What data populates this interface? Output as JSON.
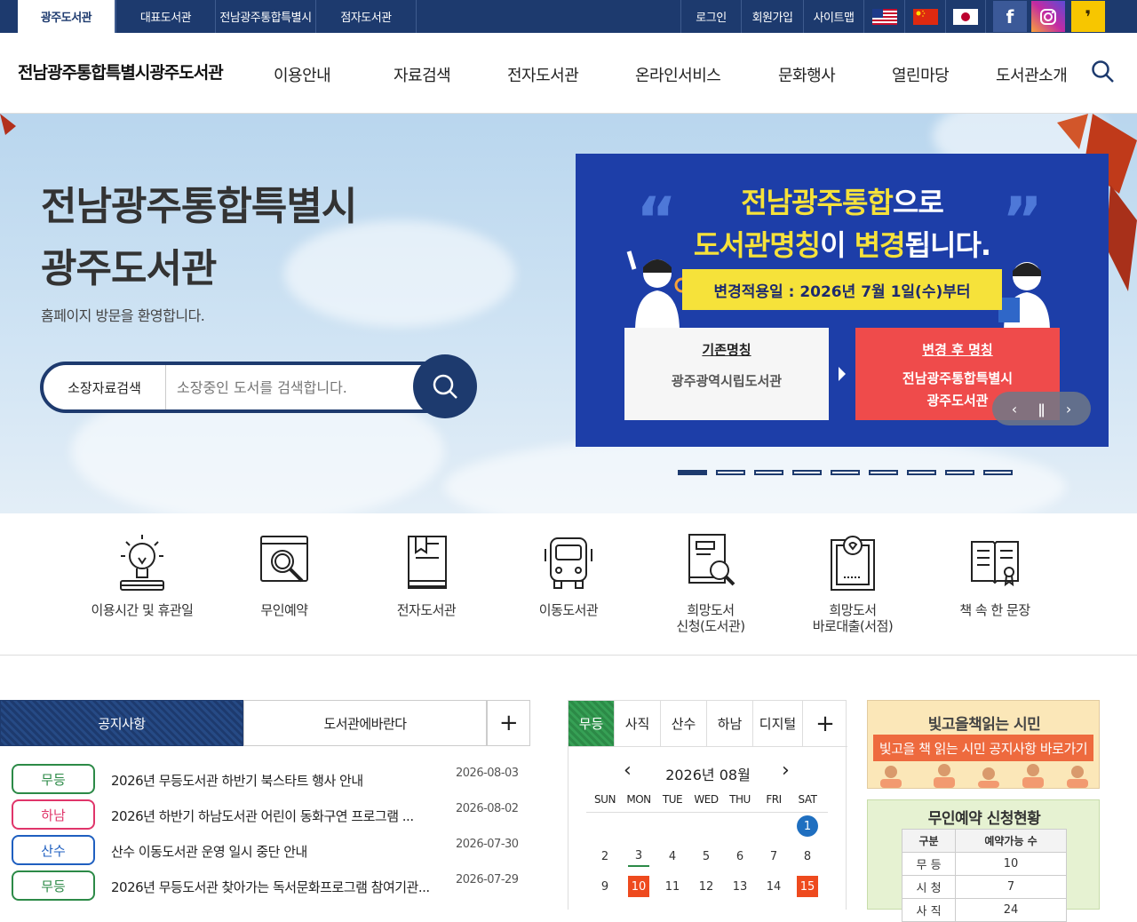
{
  "topbar": {
    "tabs": [
      "광주도서관",
      "대표도서관",
      "전남광주통합특별시",
      "점자도서관"
    ],
    "util": [
      "로그인",
      "회원가입",
      "사이트맵"
    ],
    "flags": [
      "us-flag-icon",
      "china-flag-icon",
      "japan-flag-icon"
    ],
    "social": [
      "facebook-icon",
      "instagram-icon",
      "kakaotalk-icon"
    ],
    "colors": {
      "navy": "#1d3a6e",
      "facebook": "#3b5998",
      "instagram": "#c32aa3",
      "kakao": "#f7c600"
    }
  },
  "header": {
    "logo": "전남광주통합특별시광주도서관",
    "nav": [
      "이용안내",
      "자료검색",
      "전자도서관",
      "온라인서비스",
      "문화행사",
      "열린마당",
      "도서관소개"
    ]
  },
  "hero": {
    "title_line1": "전남광주통합특별시",
    "title_line2": "광주도서관",
    "subtitle": "홈페이지 방문을 환영합니다.",
    "search_category": "소장자료검색",
    "search_placeholder": "소장중인 도서를 검색합니다."
  },
  "banner": {
    "line1_a": "전남광주통합",
    "line1_b": "으로",
    "line2_a": "도서관명칭",
    "line2_b": "이 ",
    "line2_c": "변경",
    "line2_d": "됩니다.",
    "date": "변경적용일 : 2026년 7월 1일(수)부터",
    "old_head": "기존명칭",
    "old_name": "광주광역시립도서관",
    "new_head": "변경 후 명칭",
    "new_name1": "전남광주통합특별시",
    "new_name2": "광주도서관",
    "slide_count": 9,
    "active_slide": 1
  },
  "quick": [
    {
      "label": "이용시간 및 휴관일",
      "icon": "lightbulb-book-icon"
    },
    {
      "label": "무인예약",
      "icon": "search-window-icon"
    },
    {
      "label": "전자도서관",
      "icon": "ebook-icon"
    },
    {
      "label": "이동도서관",
      "icon": "bus-icon"
    },
    {
      "label1": "희망도서",
      "label2": "신청(도서관)",
      "icon": "book-search-icon"
    },
    {
      "label1": "희망도서",
      "label2": "바로대출(서점)",
      "icon": "certificate-icon"
    },
    {
      "label": "책 속 한 문장",
      "icon": "open-book-icon"
    }
  ],
  "notice": {
    "tabs": [
      "공지사항",
      "도서관에바란다"
    ],
    "rows": [
      {
        "badge": "무등",
        "color": "#2c8a47",
        "title": "2026년 무등도서관 하반기 북스타트 행사 안내",
        "date": "2026-08-03"
      },
      {
        "badge": "하남",
        "color": "#e0356a",
        "title": "2026년 하반기 하남도서관 어린이 동화구연 프로그램 ...",
        "date": "2026-08-02"
      },
      {
        "badge": "산수",
        "color": "#1f5fc0",
        "title": "산수 이동도서관 운영 일시 중단 안내",
        "date": "2026-07-30"
      },
      {
        "badge": "무등",
        "color": "#2c8a47",
        "title": "2026년 무등도서관 찾아가는 독서문화프로그램 참여기관...",
        "date": "2026-07-29"
      }
    ]
  },
  "calendar": {
    "tabs": [
      "무등",
      "사직",
      "산수",
      "하남",
      "디지털"
    ],
    "month": "2026년 08월",
    "dow": [
      "SUN",
      "MON",
      "TUE",
      "WED",
      "THU",
      "FRI",
      "SAT"
    ],
    "row1": [
      "1"
    ],
    "row2": [
      "2",
      "3",
      "4",
      "5",
      "6",
      "7",
      "8"
    ],
    "row3": [
      "9",
      "10",
      "11",
      "12",
      "13",
      "14",
      "15"
    ]
  },
  "side": {
    "banner_title": "빛고을책읽는 시민",
    "banner_btn": "빛고을 책 읽는 시민 공지사항 바로가기",
    "reserve_title": "무인예약 신청현황",
    "col1": "구분",
    "col2": "예약가능 수",
    "rows": [
      {
        "name": "무 등",
        "count": "10"
      },
      {
        "name": "시 청",
        "count": "7"
      },
      {
        "name": "사 직",
        "count": "24"
      }
    ]
  }
}
